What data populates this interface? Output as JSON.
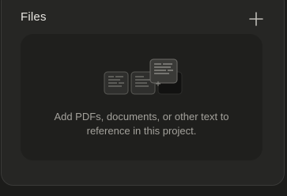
{
  "files": {
    "title": "Files",
    "add_icon": "plus-icon",
    "empty_state": {
      "line1": "Add PDFs, documents, or other text to",
      "line2": "reference in this project.",
      "illustration_icon": "document-stack-icon"
    }
  },
  "colors": {
    "panel_bg": "#262624",
    "dropzone_bg": "#1f1f1d",
    "title_text": "#e6e4df",
    "muted_text": "#a3a19b"
  }
}
